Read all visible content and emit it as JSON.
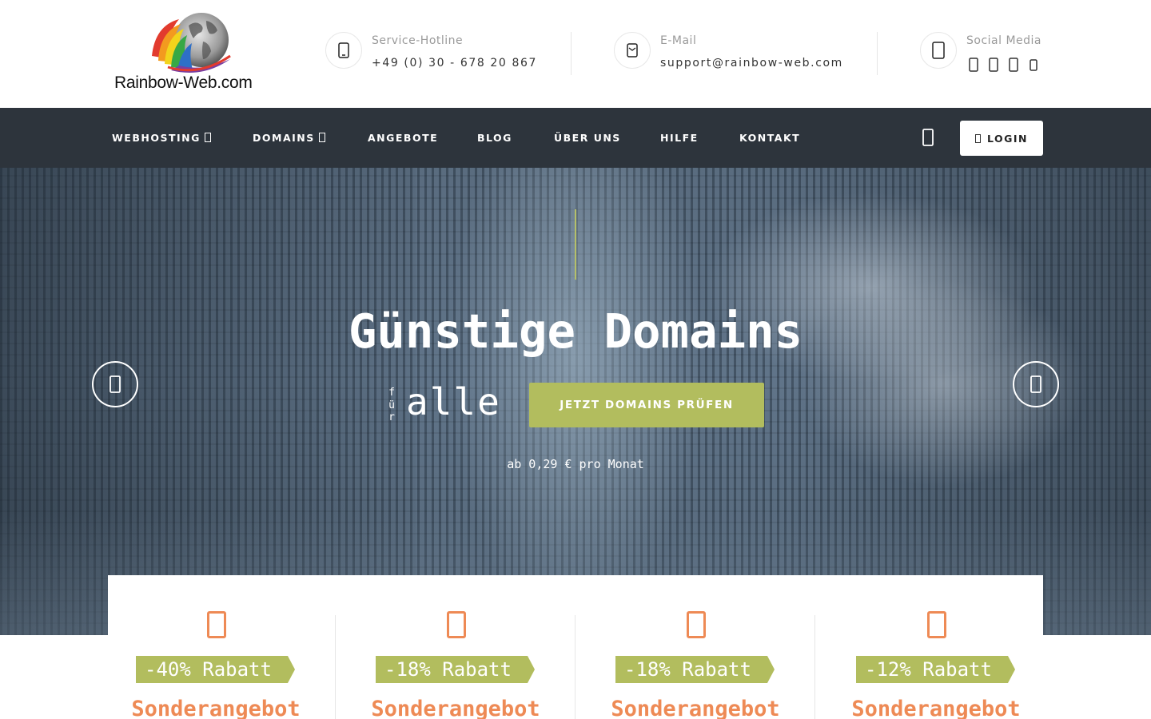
{
  "brand": {
    "name": "Rainbow-Web.com"
  },
  "contact": {
    "hotline_label": "Service-Hotline",
    "hotline_value": "+49 (0) 30 - 678 20 867",
    "email_label": "E-Mail",
    "email_value": "support@rainbow-web.com",
    "social_label": "Social Media",
    "social_icons": [
      "facebook-icon",
      "twitter-icon",
      "google-plus-icon",
      "linkedin-icon"
    ]
  },
  "nav": {
    "items": [
      {
        "label": "WEBHOSTING",
        "dropdown": true
      },
      {
        "label": "DOMAINS",
        "dropdown": true
      },
      {
        "label": "ANGEBOTE",
        "dropdown": false
      },
      {
        "label": "BLOG",
        "dropdown": false
      },
      {
        "label": "ÜBER UNS",
        "dropdown": false
      },
      {
        "label": "HILFE",
        "dropdown": false
      },
      {
        "label": "KONTAKT",
        "dropdown": false
      }
    ],
    "login_label": "LOGIN"
  },
  "hero": {
    "title": "Günstige Domains",
    "small_word": "für",
    "big_word": "alle",
    "cta_label": "JETZT DOMAINS PRÜFEN",
    "subtitle": "ab 0,29 € pro Monat"
  },
  "offers": [
    {
      "badge": "-40% Rabatt",
      "title": "Sonderangebot"
    },
    {
      "badge": "-18% Rabatt",
      "title": "Sonderangebot"
    },
    {
      "badge": "-18% Rabatt",
      "title": "Sonderangebot"
    },
    {
      "badge": "-12% Rabatt",
      "title": "Sonderangebot"
    }
  ],
  "colors": {
    "nav_bg": "#2d343c",
    "accent_green": "#b2bd5e",
    "accent_orange": "#ee8a55",
    "vline": "#b5c06a"
  }
}
